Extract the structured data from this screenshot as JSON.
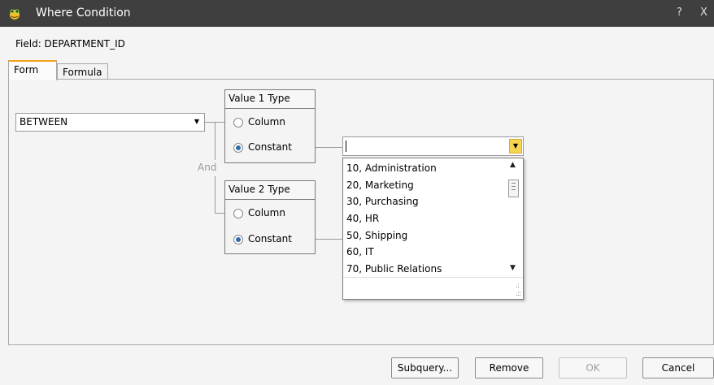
{
  "window": {
    "title": "Where Condition",
    "help_glyph": "?",
    "close_glyph": "X"
  },
  "field": {
    "label": "Field: DEPARTMENT_ID"
  },
  "tabs": [
    {
      "label": "Form",
      "selected": true
    },
    {
      "label": "Formula",
      "selected": false
    }
  ],
  "operator": {
    "value": "BETWEEN"
  },
  "connector": {
    "label": "And"
  },
  "value1": {
    "title": "Value 1 Type",
    "mnemonic_char": "1",
    "options": [
      {
        "label": "Column",
        "selected": false
      },
      {
        "label": "Constant",
        "selected": true
      }
    ]
  },
  "value2": {
    "title": "Value 2 Type",
    "mnemonic_char": "2",
    "options": [
      {
        "label": "Column",
        "selected": false
      },
      {
        "label": "Constant",
        "selected": true
      }
    ]
  },
  "constant_combo": {
    "value": ""
  },
  "dropdown": {
    "items": [
      "10, Administration",
      "20, Marketing",
      "30, Purchasing",
      "40, HR",
      "50, Shipping",
      "60, IT",
      "70, Public Relations"
    ]
  },
  "buttons": {
    "subquery": "Subquery...",
    "remove": "Remove",
    "ok": "OK",
    "cancel": "Cancel"
  },
  "colors": {
    "titlebar": "#3f3f3f",
    "tab_accent": "#f3a21c",
    "combo_button": "#f7d44f",
    "radio_dot": "#2f6ea8"
  },
  "icons": {
    "app": "frog-logo-icon",
    "combo_arrow": "chevron-down-icon",
    "scroll_up": "arrow-up-icon",
    "scroll_down": "arrow-down-icon"
  }
}
